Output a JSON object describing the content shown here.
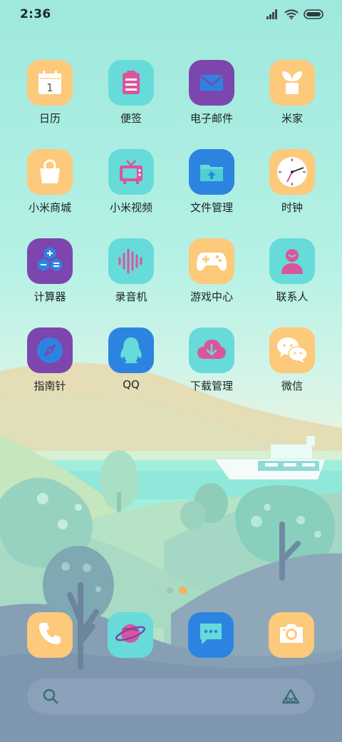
{
  "status_bar": {
    "time": "2:36"
  },
  "apps": [
    {
      "label": "日历",
      "icon": "calendar-icon",
      "calendar_day": "1"
    },
    {
      "label": "便签",
      "icon": "notes-icon"
    },
    {
      "label": "电子邮件",
      "icon": "mail-icon"
    },
    {
      "label": "米家",
      "icon": "plant-icon"
    },
    {
      "label": "小米商城",
      "icon": "shopping-bag-icon"
    },
    {
      "label": "小米视频",
      "icon": "tv-icon"
    },
    {
      "label": "文件管理",
      "icon": "folder-icon"
    },
    {
      "label": "时钟",
      "icon": "clock-icon"
    },
    {
      "label": "计算器",
      "icon": "calculator-icon"
    },
    {
      "label": "录音机",
      "icon": "sound-wave-icon"
    },
    {
      "label": "游戏中心",
      "icon": "gamepad-icon"
    },
    {
      "label": "联系人",
      "icon": "person-icon"
    },
    {
      "label": "指南针",
      "icon": "compass-icon"
    },
    {
      "label": "QQ",
      "icon": "penguin-icon"
    },
    {
      "label": "下载管理",
      "icon": "download-cloud-icon"
    },
    {
      "label": "微信",
      "icon": "chat-bubbles-icon"
    }
  ],
  "dock": [
    {
      "icon": "phone-icon"
    },
    {
      "icon": "planet-icon"
    },
    {
      "icon": "message-icon"
    },
    {
      "icon": "camera-icon"
    }
  ],
  "colors": {
    "orange": "#fdc97a",
    "teal": "#67dbd9",
    "purple": "#7d46ae",
    "blue": "#2d84e0",
    "pink": "#d9569c",
    "active_dot": "#f3b456"
  }
}
